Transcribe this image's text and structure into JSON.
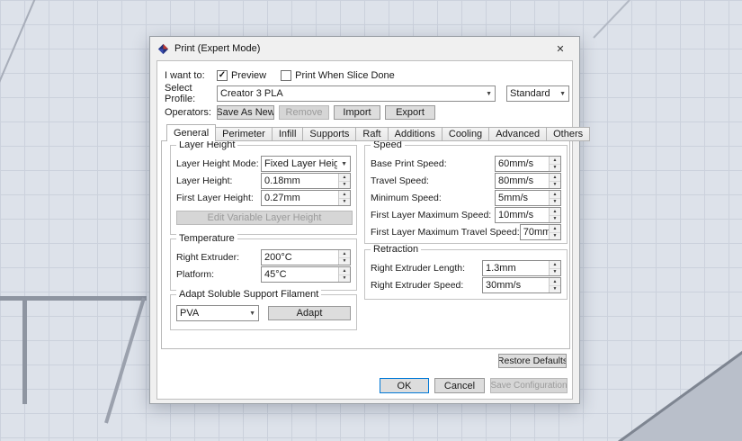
{
  "colors": {
    "accent": "#0078d7"
  },
  "icons": {
    "close": "✕",
    "check": "✓",
    "dropdown": "▼",
    "spin_up": "▲",
    "spin_down": "▼"
  },
  "window": {
    "title": "Print (Expert Mode)"
  },
  "header": {
    "i_want_to": "I want to:",
    "preview": "Preview",
    "print_when_slice_done": "Print When Slice Done",
    "select_profile": "Select Profile:",
    "profile_value": "Creator 3 PLA",
    "profile_type_value": "Standard",
    "operators": "Operators:",
    "save_as_new": "Save As New",
    "remove": "Remove",
    "import": "Import",
    "export": "Export"
  },
  "tabs": [
    "General",
    "Perimeter",
    "Infill",
    "Supports",
    "Raft",
    "Additions",
    "Cooling",
    "Advanced",
    "Others"
  ],
  "active_tab": "General",
  "layer_height": {
    "legend": "Layer Height",
    "mode_label": "Layer Height Mode:",
    "mode_value": "Fixed Layer Height",
    "height_label": "Layer Height:",
    "height_value": "0.18mm",
    "first_layer_label": "First Layer Height:",
    "first_layer_value": "0.27mm",
    "edit_variable_button": "Edit Variable Layer Height"
  },
  "temperature": {
    "legend": "Temperature",
    "right_extruder_label": "Right Extruder:",
    "right_extruder_value": "200°C",
    "platform_label": "Platform:",
    "platform_value": "45°C"
  },
  "adapt": {
    "legend": "Adapt Soluble Support Filament",
    "material_value": "PVA",
    "adapt_button": "Adapt"
  },
  "speed": {
    "legend": "Speed",
    "rows": [
      {
        "label": "Base Print Speed:",
        "value": "60mm/s"
      },
      {
        "label": "Travel Speed:",
        "value": "80mm/s"
      },
      {
        "label": "Minimum Speed:",
        "value": "5mm/s"
      },
      {
        "label": "First Layer Maximum Speed:",
        "value": "10mm/s"
      },
      {
        "label": "First Layer Maximum Travel Speed:",
        "value": "70mm/s"
      }
    ]
  },
  "retraction": {
    "legend": "Retraction",
    "rows": [
      {
        "label": "Right Extruder Length:",
        "value": "1.3mm"
      },
      {
        "label": "Right Extruder Speed:",
        "value": "30mm/s"
      }
    ]
  },
  "footer": {
    "restore_defaults": "Restore Defaults",
    "ok": "OK",
    "cancel": "Cancel",
    "save_configuration": "Save Configuration"
  }
}
